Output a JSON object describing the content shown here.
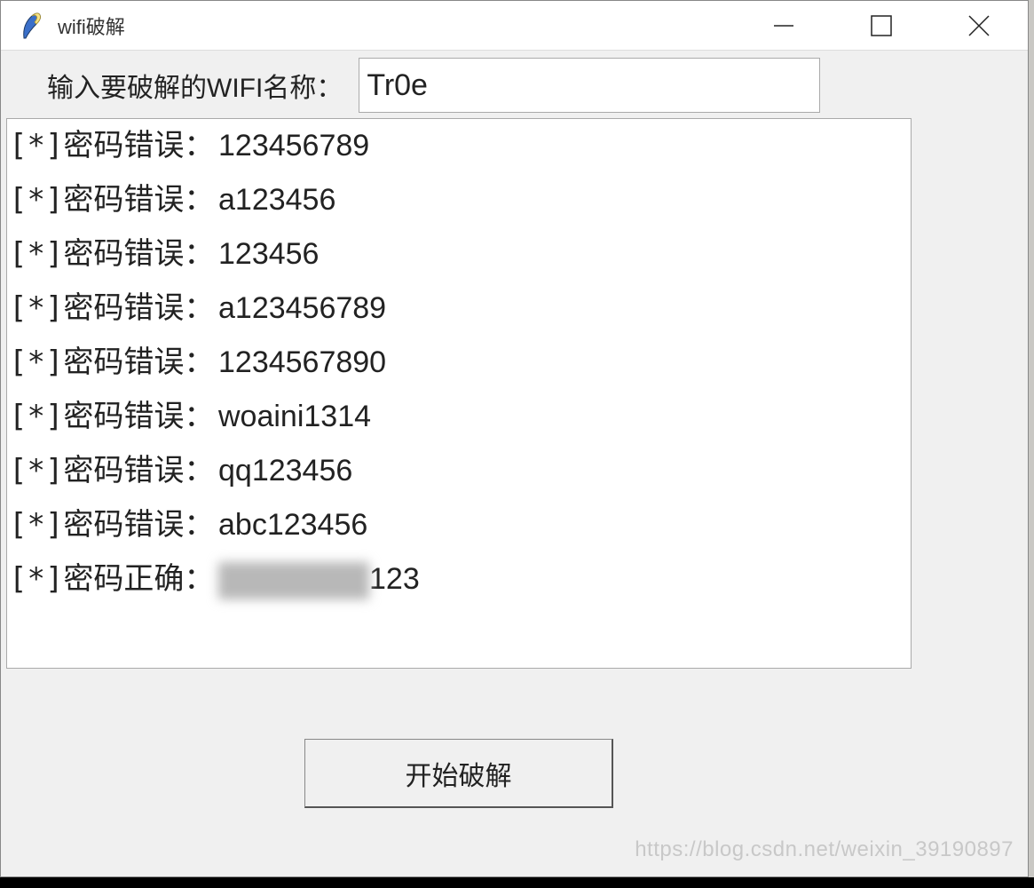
{
  "window": {
    "title": "wifi破解"
  },
  "form": {
    "label": "输入要破解的WIFI名称：",
    "value": "Tr0e"
  },
  "log": {
    "prefix": "[*]",
    "wrong_label": "密码错误：",
    "correct_label": "密码正确：",
    "items": [
      {
        "status": "wrong",
        "value": "123456789"
      },
      {
        "status": "wrong",
        "value": "a123456"
      },
      {
        "status": "wrong",
        "value": "123456"
      },
      {
        "status": "wrong",
        "value": "a123456789"
      },
      {
        "status": "wrong",
        "value": "1234567890"
      },
      {
        "status": "wrong",
        "value": "woaini1314"
      },
      {
        "status": "wrong",
        "value": "qq123456"
      },
      {
        "status": "wrong",
        "value": "abc123456"
      },
      {
        "status": "correct",
        "value": "123",
        "redacted_prefix": true
      }
    ]
  },
  "button": {
    "start": "开始破解"
  },
  "watermark": "https://blog.csdn.net/weixin_39190897"
}
